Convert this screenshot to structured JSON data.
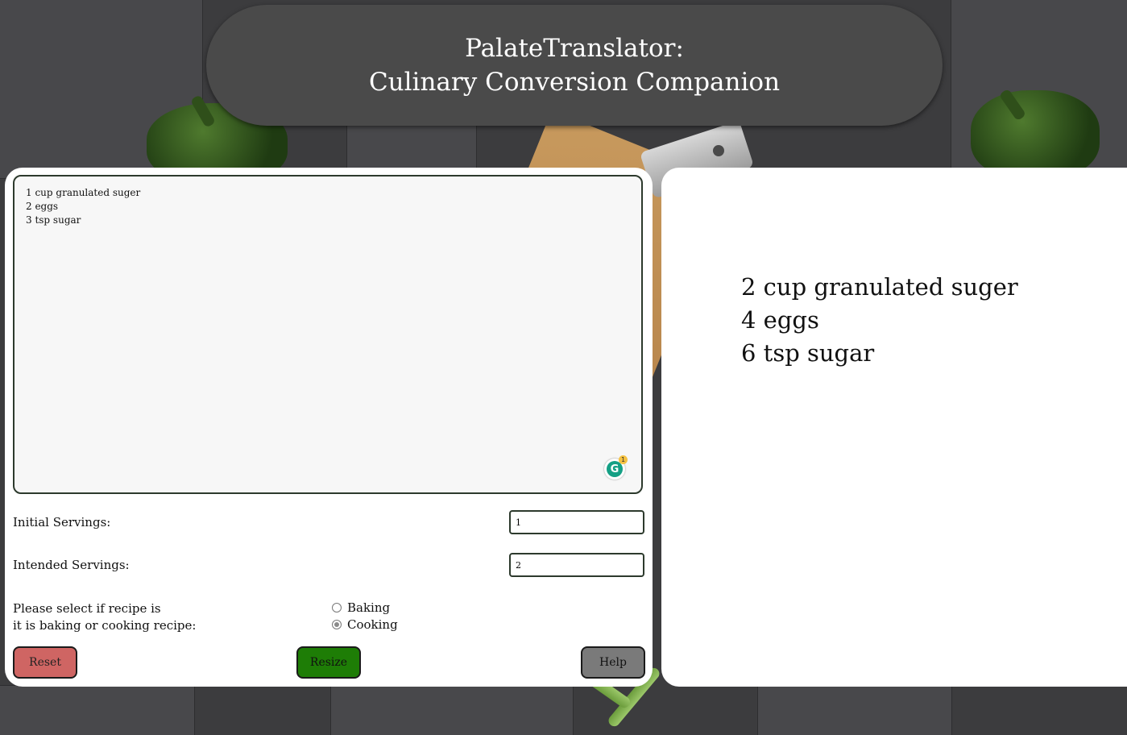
{
  "header": {
    "title_line1": "PalateTranslator:",
    "title_line2": "Culinary Conversion Companion"
  },
  "recipe_input": {
    "value": "1 cup granulated suger\n2 eggs\n3 tsp sugar",
    "grammarly_icon": "grammarly-icon",
    "grammarly_badge": "1"
  },
  "servings": {
    "initial_label": "Initial Servings:",
    "initial_value": "1",
    "intended_label": "Intended Servings:",
    "intended_value": "2"
  },
  "recipe_type": {
    "prompt_line1": "Please select if recipe is",
    "prompt_line2": "it is baking or cooking recipe:",
    "options": [
      {
        "label": "Baking",
        "checked": false
      },
      {
        "label": "Cooking",
        "checked": true
      }
    ]
  },
  "buttons": {
    "reset": "Reset",
    "resize": "Resize",
    "help": "Help"
  },
  "result": {
    "lines": [
      "2 cup granulated suger",
      "4 eggs",
      "6 tsp sugar"
    ]
  },
  "colors": {
    "header_bg": "#4a4a4a",
    "reset": "#cf6563",
    "resize": "#1e7d06",
    "help": "#7a7a7a"
  }
}
